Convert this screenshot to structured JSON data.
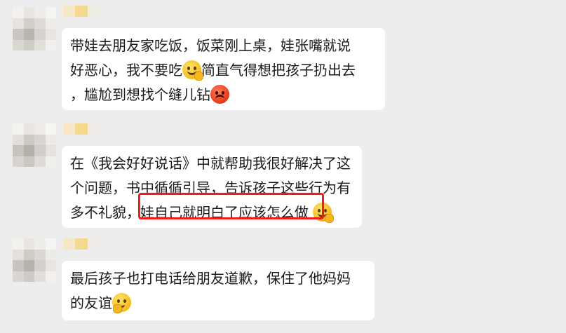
{
  "messages": [
    {
      "lines": [
        "带娃去朋友家吃饭，饭菜刚上桌，娃张嘴就说",
        "好恶心，我不要吃",
        "简直气得想把孩子扔出去",
        "，尴尬到想找个缝儿钻"
      ]
    },
    {
      "lines": [
        "在《我会好好说话》中就帮助我很好解决了这",
        "个问题，书中循循引导，告诉孩子这些行为有",
        "多不礼貌，",
        "娃自己就明白了应该怎么做"
      ]
    },
    {
      "lines": [
        "最后孩子也打电话给朋友道歉，保住了他妈妈",
        "的友谊"
      ]
    }
  ],
  "emojis": [
    "grimace-emoji",
    "angry-emoji",
    "smile-emoji",
    "thinking-emoji"
  ],
  "colors": {
    "background": "#ededed",
    "bubble": "#ffffff",
    "highlight": "#ee1c1c"
  }
}
